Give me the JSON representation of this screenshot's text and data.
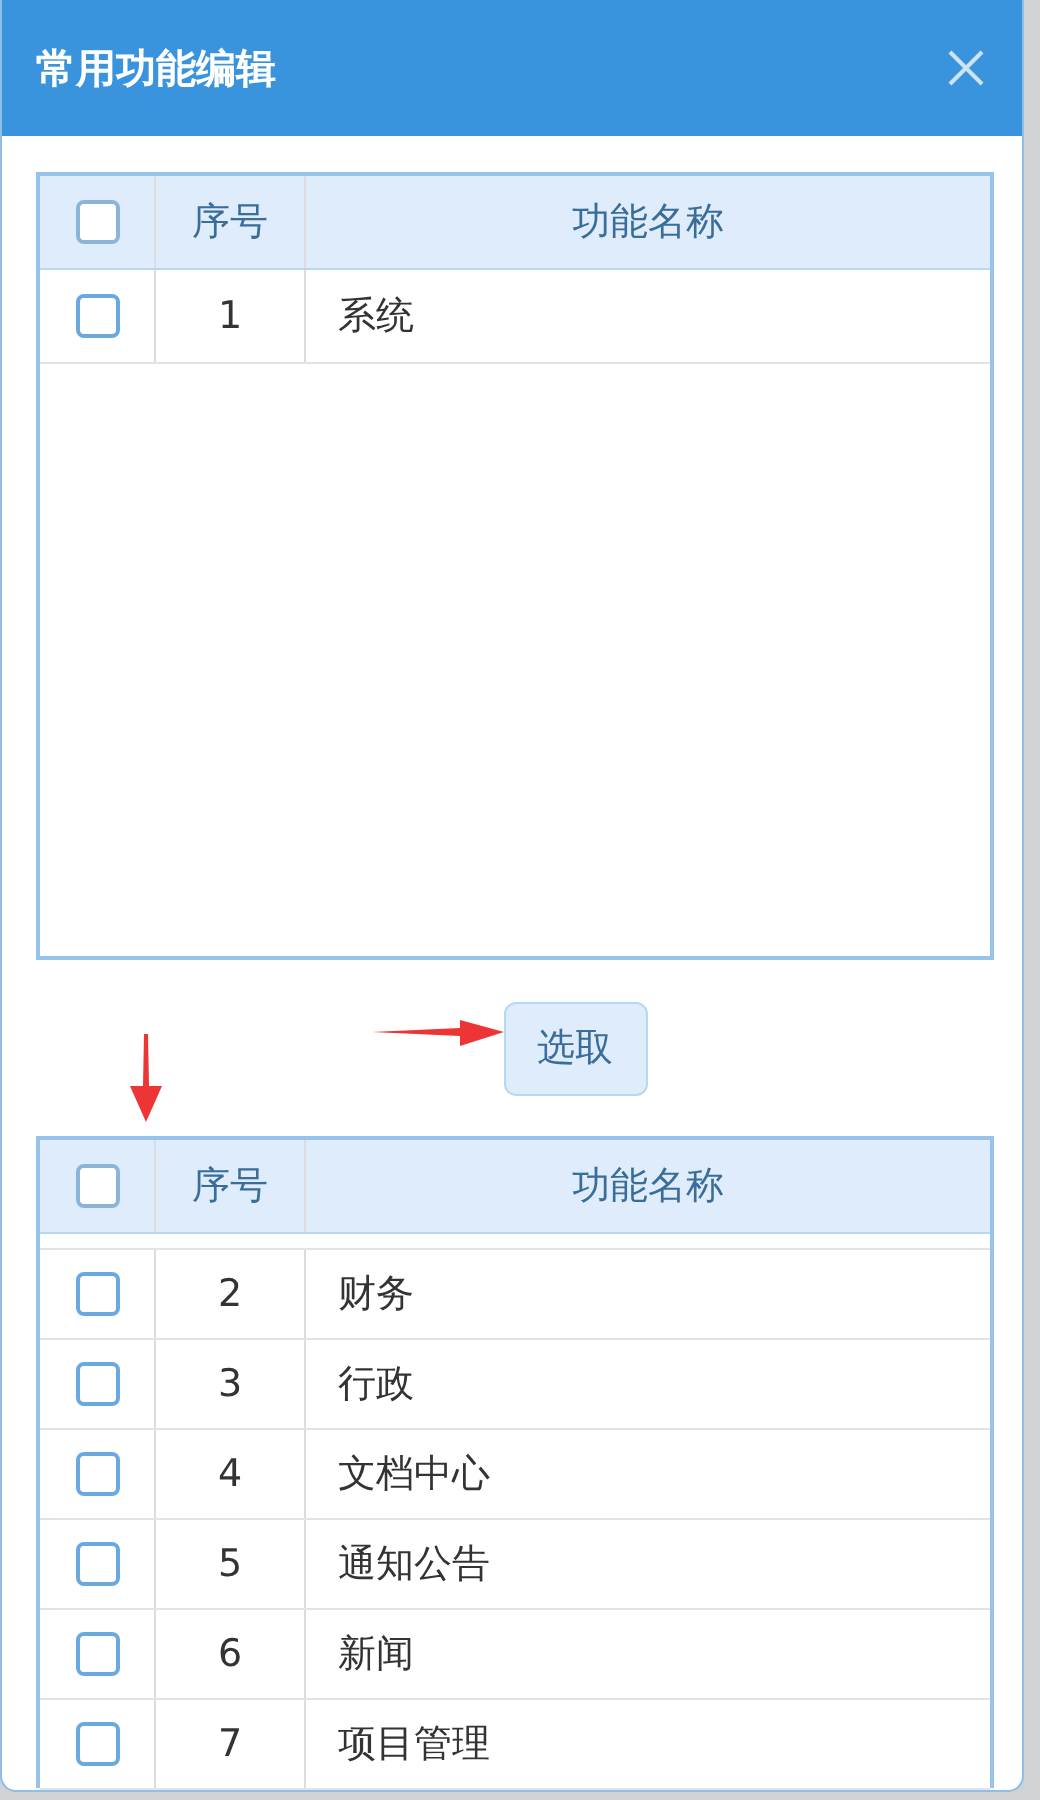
{
  "dialog": {
    "title": "常用功能编辑"
  },
  "tables": [
    {
      "columns": [
        "序号",
        "功能名称"
      ],
      "header_checked": false,
      "rows": [
        {
          "index": "1",
          "name": "系统",
          "checked": false
        }
      ]
    },
    {
      "columns": [
        "序号",
        "功能名称"
      ],
      "header_checked": false,
      "rows": [
        {
          "index": "2",
          "name": "财务",
          "checked": false
        },
        {
          "index": "3",
          "name": "行政",
          "checked": false
        },
        {
          "index": "4",
          "name": "文档中心",
          "checked": false
        },
        {
          "index": "5",
          "name": "通知公告",
          "checked": false
        },
        {
          "index": "6",
          "name": "新闻",
          "checked": false
        },
        {
          "index": "7",
          "name": "项目管理",
          "checked": false
        }
      ]
    }
  ],
  "select_button": {
    "label": "选取"
  }
}
